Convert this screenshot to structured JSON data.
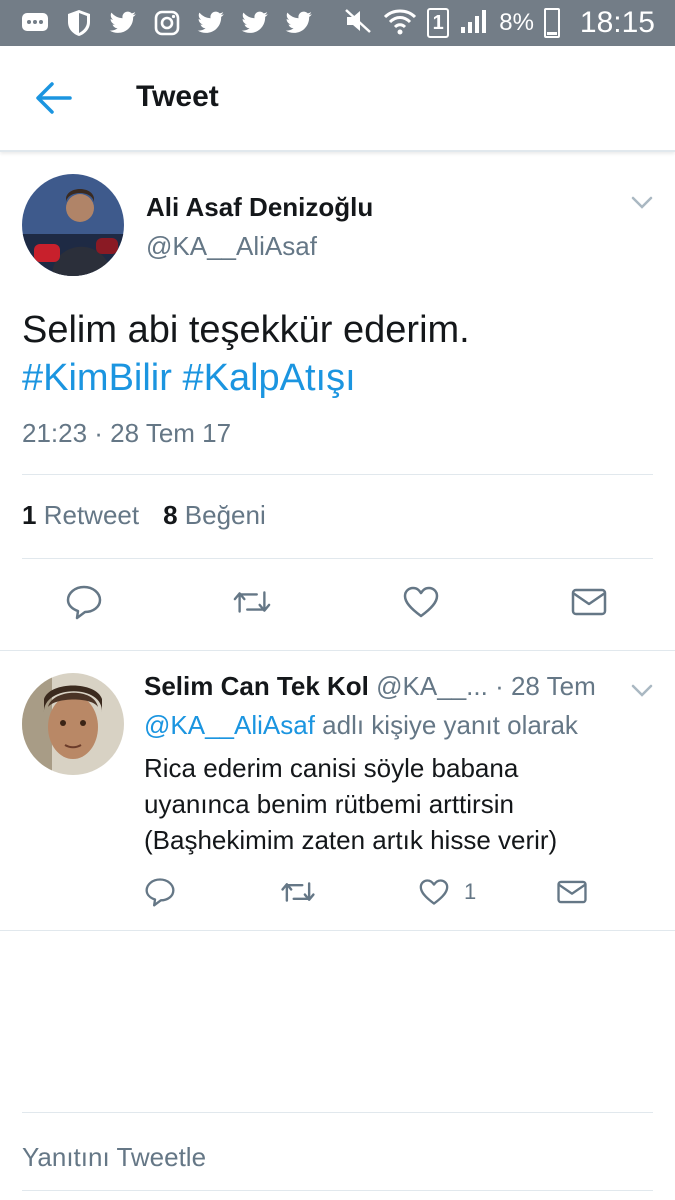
{
  "status_bar": {
    "battery_percent": "8%",
    "sim_slot": "1",
    "time": "18:15",
    "icons": [
      "chat-icon",
      "shield-icon",
      "twitter-icon",
      "instagram-icon",
      "twitter-icon",
      "twitter-icon",
      "twitter-icon",
      "mute-icon",
      "wifi-icon",
      "sim-icon",
      "signal-icon",
      "battery-icon"
    ]
  },
  "header": {
    "title": "Tweet"
  },
  "tweet": {
    "author_name": "Ali Asaf Denizoğlu",
    "author_handle": "@KA__AliAsaf",
    "text": "Selim abi teşekkür ederim.",
    "hashtags": [
      "#KimBilir",
      "#KalpAtışı"
    ],
    "timestamp": "21:23 · 28 Tem 17",
    "retweet_count": "1",
    "retweet_label": "Retweet",
    "like_count": "8",
    "like_label": "Beğeni"
  },
  "reply": {
    "author_name": "Selim Can Tek Kol",
    "author_handle": "@KA__...",
    "date": "· 28 Tem",
    "reply_to_mention": "@KA__AliAsaf",
    "reply_to_suffix": " adlı kişiye yanıt olarak",
    "lines": [
      "Rica ederim canisi söyle babana",
      "uyanınca benim rütbemi arttirsin",
      "(Başhekimim zaten artık hisse verir)"
    ],
    "like_count": "1"
  },
  "compose": {
    "placeholder": "Yanıtını Tweetle"
  },
  "colors": {
    "accent": "#1b95e0",
    "secondary_text": "#657786",
    "status_bar": "#737d87",
    "divider": "#e1e8ed"
  }
}
